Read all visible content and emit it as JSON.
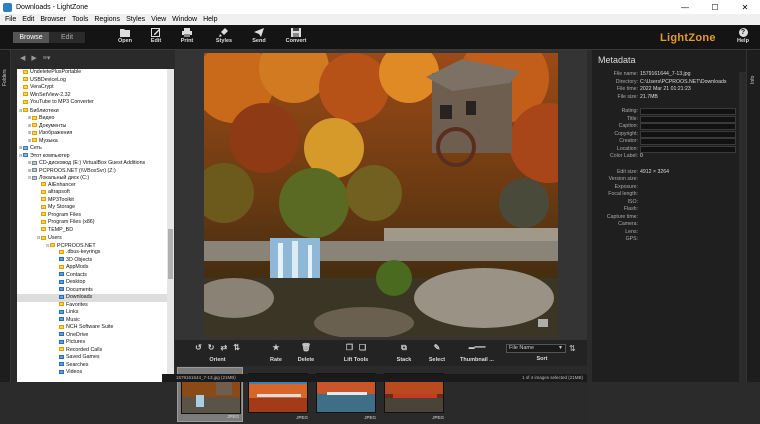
{
  "window": {
    "title": "Downloads - LightZone",
    "minimize": "—",
    "maximize": "☐",
    "close": "✕"
  },
  "menu": [
    "File",
    "Edit",
    "Browser",
    "Tools",
    "Regions",
    "Styles",
    "View",
    "Window",
    "Help"
  ],
  "modes": {
    "browse": "Browse",
    "edit": "Edit"
  },
  "toolbar": {
    "open": "Open",
    "edit": "Edit",
    "print": "Print",
    "styles": "Styles",
    "send": "Send",
    "convert": "Convert",
    "help": "Help"
  },
  "logo": "LightZone",
  "side_tabs": {
    "folders": "Folders",
    "info": "Info"
  },
  "tree": [
    {
      "label": "UndeletePlusPortable",
      "depth": 0,
      "icon": "folder"
    },
    {
      "label": "USBDeviceLog",
      "depth": 0,
      "icon": "folder"
    },
    {
      "label": "VeraCrypt",
      "depth": 0,
      "icon": "folder"
    },
    {
      "label": "WinSetView-2.32",
      "depth": 0,
      "icon": "folder"
    },
    {
      "label": "YouTube to MP3 Converter",
      "depth": 0,
      "icon": "folder"
    },
    {
      "label": "Библиотеки",
      "depth": 0,
      "icon": "folder",
      "exp": "⊟"
    },
    {
      "label": "Видео",
      "depth": 1,
      "icon": "folder",
      "exp": "⊞"
    },
    {
      "label": "Документы",
      "depth": 1,
      "icon": "folder",
      "exp": "⊞"
    },
    {
      "label": "Изображения",
      "depth": 1,
      "icon": "folder",
      "exp": "⊞"
    },
    {
      "label": "Музыка",
      "depth": 1,
      "icon": "folder",
      "exp": "⊞"
    },
    {
      "label": "Сеть",
      "depth": 0,
      "icon": "pc",
      "exp": "⊞"
    },
    {
      "label": "Этот компьютер",
      "depth": 0,
      "icon": "pc",
      "exp": "⊟"
    },
    {
      "label": "CD-дисковод (E:) VirtualBox Guest Additions",
      "depth": 1,
      "icon": "drive",
      "exp": "⊞"
    },
    {
      "label": "PCPROOS.NET (\\\\VBoxSvr) (Z:)",
      "depth": 1,
      "icon": "drive",
      "exp": "⊞"
    },
    {
      "label": "Локальный диск (C:)",
      "depth": 1,
      "icon": "drive",
      "exp": "⊟"
    },
    {
      "label": "AIEnhancer",
      "depth": 2,
      "icon": "folder"
    },
    {
      "label": "altrapsoft",
      "depth": 2,
      "icon": "folder"
    },
    {
      "label": "MP3Toolkit",
      "depth": 2,
      "icon": "folder"
    },
    {
      "label": "My Storage",
      "depth": 2,
      "icon": "folder"
    },
    {
      "label": "Program Files",
      "depth": 2,
      "icon": "folder"
    },
    {
      "label": "Program Files (x86)",
      "depth": 2,
      "icon": "folder"
    },
    {
      "label": "TEMP_BD",
      "depth": 2,
      "icon": "folder"
    },
    {
      "label": "Users",
      "depth": 2,
      "icon": "folder",
      "exp": "⊟"
    },
    {
      "label": "PCPROOS.NET",
      "depth": 3,
      "icon": "folder",
      "exp": "⊟"
    },
    {
      "label": ".dbus-keyrings",
      "depth": 4,
      "icon": "folder"
    },
    {
      "label": "3D Objects",
      "depth": 4,
      "icon": "blue"
    },
    {
      "label": "AppMods",
      "depth": 4,
      "icon": "folder"
    },
    {
      "label": "Contacts",
      "depth": 4,
      "icon": "blue"
    },
    {
      "label": "Desktop",
      "depth": 4,
      "icon": "blue"
    },
    {
      "label": "Documents",
      "depth": 4,
      "icon": "blue"
    },
    {
      "label": "Downloads",
      "depth": 4,
      "icon": "blue",
      "selected": true
    },
    {
      "label": "Favorites",
      "depth": 4,
      "icon": "folder"
    },
    {
      "label": "Links",
      "depth": 4,
      "icon": "blue"
    },
    {
      "label": "Music",
      "depth": 4,
      "icon": "blue"
    },
    {
      "label": "NCH Software Suite",
      "depth": 4,
      "icon": "folder"
    },
    {
      "label": "OneDrive",
      "depth": 4,
      "icon": "blue"
    },
    {
      "label": "Pictures",
      "depth": 4,
      "icon": "blue"
    },
    {
      "label": "Recorded Calls",
      "depth": 4,
      "icon": "folder"
    },
    {
      "label": "Saved Games",
      "depth": 4,
      "icon": "blue"
    },
    {
      "label": "Searches",
      "depth": 4,
      "icon": "blue"
    },
    {
      "label": "Videos",
      "depth": 4,
      "icon": "blue"
    }
  ],
  "midbar": {
    "orient": "Orient",
    "rate": "Rate",
    "delete": "Delete",
    "lift_tools": "Lift Tools",
    "stack": "Stack",
    "select": "Select",
    "thumbnail": "Thumbnail ...",
    "sort": "Sort",
    "sort_value": "File Name"
  },
  "thumbnails": [
    {
      "badge": "JPEG",
      "selected": true
    },
    {
      "badge": "JPEG",
      "selected": false
    },
    {
      "badge": "JPEG",
      "selected": false
    },
    {
      "badge": "JPEG",
      "selected": false
    }
  ],
  "status": {
    "left": "1579161644_7-13.jpg (21MB)",
    "right": "1 of 4 images selected (21MB)"
  },
  "metadata": {
    "header": "Metadata",
    "file": [
      {
        "k": "File name:",
        "v": "1579161644_7-13.jpg"
      },
      {
        "k": "Directory:",
        "v": "C:\\Users\\PCPROOS.NET\\Downloads"
      },
      {
        "k": "File time:",
        "v": "2022 Mar 21 01:21:23"
      },
      {
        "k": "File size:",
        "v": "21.7MB"
      }
    ],
    "fields": [
      "Rating:",
      "Title:",
      "Caption:",
      "Copyright:",
      "Creator:",
      "Location:"
    ],
    "color_label": {
      "k": "Color Label:",
      "v": "0"
    },
    "camera": [
      {
        "k": "Edit size:",
        "v": "4912 × 3264"
      },
      {
        "k": "Version size:",
        "v": ""
      },
      {
        "k": "Exposure:",
        "v": ""
      },
      {
        "k": "Focal length:",
        "v": ""
      },
      {
        "k": "ISO:",
        "v": ""
      },
      {
        "k": "Flash:",
        "v": ""
      },
      {
        "k": "Capture time:",
        "v": ""
      },
      {
        "k": "Camera:",
        "v": ""
      },
      {
        "k": "Lens:",
        "v": ""
      },
      {
        "k": "GPS:",
        "v": ""
      }
    ]
  },
  "colors": {
    "accent": "#e49a2e",
    "background": "#2b2b2b"
  }
}
